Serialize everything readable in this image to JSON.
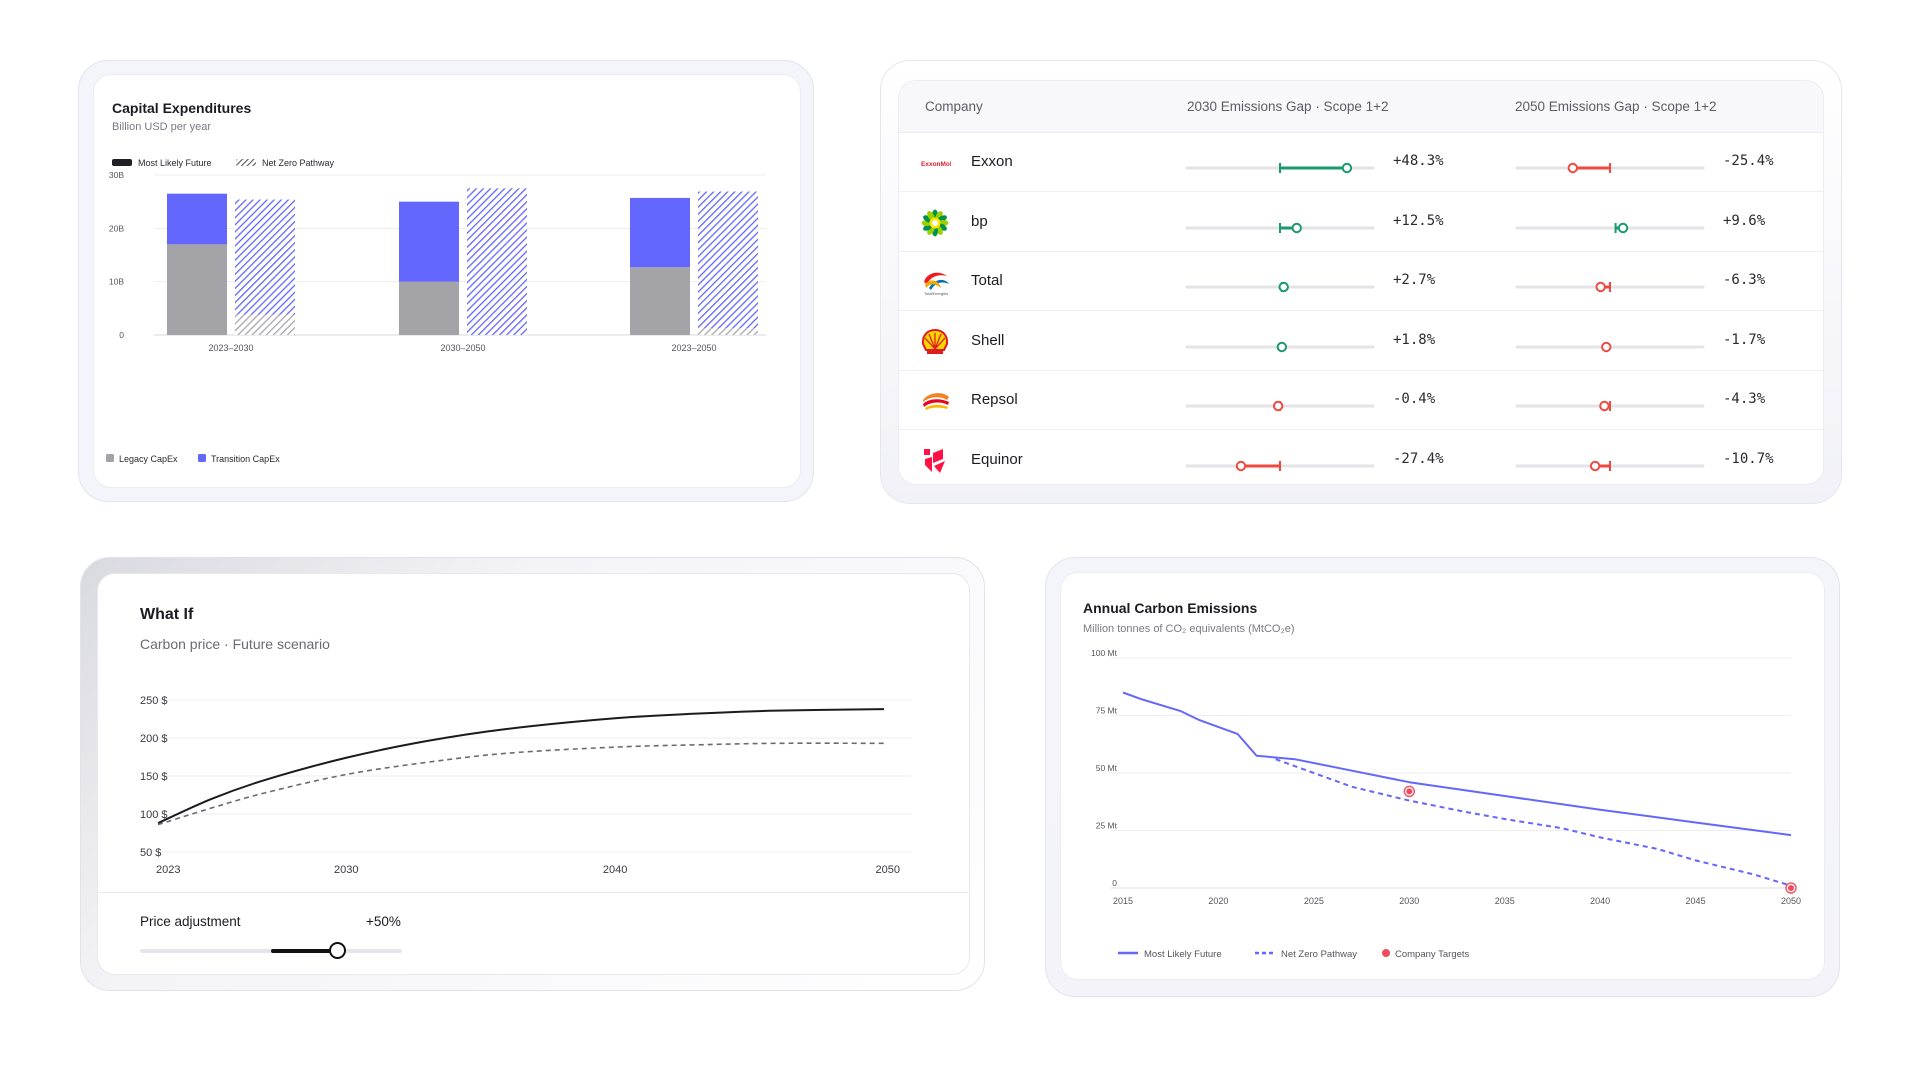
{
  "capex": {
    "title": "Capital Expenditures",
    "subtitle": "Billion USD per year",
    "legend_top": [
      "Most Likely Future",
      "Net Zero Pathway"
    ],
    "legend_bottom": [
      "Legacy CapEx",
      "Transition CapEx"
    ]
  },
  "emissions_gap": {
    "headers": [
      "Company",
      "2030 Emissions Gap · Scope 1+2",
      "2050 Emissions Gap · Scope 1+2"
    ],
    "rows": [
      {
        "company": "Exxon",
        "logo_icon": "exxonmobil-logo-icon",
        "logo_text": "ExxonMobil",
        "gap_2030": "+48.3%",
        "gap_2050": "-25.4%",
        "r2030": [
          50,
          86
        ],
        "r2050": [
          30,
          50
        ]
      },
      {
        "company": "bp",
        "logo_icon": "bp-helios-logo-icon",
        "gap_2030": "+12.5%",
        "gap_2050": "+9.6%",
        "r2030": [
          50,
          59
        ],
        "r2050": [
          53,
          57
        ]
      },
      {
        "company": "Total",
        "logo_icon": "totalenergies-logo-icon",
        "gap_2030": "+2.7%",
        "gap_2050": "-6.3%",
        "r2030": [
          51,
          52
        ],
        "r2050": [
          45,
          50
        ]
      },
      {
        "company": "Shell",
        "logo_icon": "shell-logo-icon",
        "gap_2030": "+1.8%",
        "gap_2050": "-1.7%",
        "r2030": [
          51,
          51
        ],
        "r2050": [
          48,
          48
        ]
      },
      {
        "company": "Repsol",
        "logo_icon": "repsol-logo-icon",
        "gap_2030": "-0.4%",
        "gap_2050": "-4.3%",
        "r2030": [
          49,
          50
        ],
        "r2050": [
          47,
          50
        ]
      },
      {
        "company": "Equinor",
        "logo_icon": "equinor-logo-icon",
        "gap_2030": "-27.4%",
        "gap_2050": "-10.7%",
        "r2030": [
          29,
          50
        ],
        "r2050": [
          42,
          50
        ]
      }
    ],
    "colors": {
      "positive": "#1a9a6c",
      "negative": "#ef4a42",
      "track": "#e3e3e8"
    }
  },
  "whatif": {
    "title": "What If",
    "subtitle": "Carbon price · Future scenario",
    "slider_label": "Price adjustment",
    "slider_value": "+50%",
    "slider_fraction": 0.75
  },
  "emissions": {
    "title": "Annual Carbon Emissions",
    "subtitle": "Million tonnes of CO₂ equivalents (MtCO₂e)",
    "legend": [
      "Most Likely Future",
      "Net Zero Pathway",
      "Company Targets"
    ]
  },
  "chart_data": [
    {
      "id": "capex",
      "type": "bar",
      "title": "Capital Expenditures",
      "subtitle": "Billion USD per year",
      "categories": [
        "2023–2030",
        "2030–2050",
        "2023–2050"
      ],
      "ylim": [
        0,
        30
      ],
      "ytick_labels": [
        "0",
        "10B",
        "20B",
        "30B"
      ],
      "yticks": [
        0,
        10,
        20,
        30
      ],
      "stacked": true,
      "series": [
        {
          "name": "Most Likely Future",
          "legacy": [
            17,
            10,
            12.7
          ],
          "transition": [
            9.5,
            15,
            13
          ]
        },
        {
          "name": "Net Zero Pathway",
          "legacy": [
            3.8,
            0,
            1.3
          ],
          "transition": [
            21.6,
            27.5,
            25.6
          ]
        }
      ],
      "colors": {
        "legacy": "#a3a3a8",
        "transition": "#6467fb",
        "legacy_hatch": "#bdbdc2",
        "transition_hatch": "#6467fb"
      },
      "grid": true
    },
    {
      "id": "carbon_price",
      "type": "line",
      "x": [
        2023,
        2025,
        2027,
        2030,
        2033,
        2036,
        2040,
        2043,
        2046,
        2050
      ],
      "xticks": [
        2023,
        2030,
        2040,
        2050
      ],
      "ylim": [
        50,
        250
      ],
      "yticks": [
        50,
        100,
        150,
        200,
        250
      ],
      "ytick_labels": [
        "50 $",
        "100 $",
        "150 $",
        "200 $",
        "250 $"
      ],
      "series": [
        {
          "name": "",
          "style": "solid",
          "color": "#1b1b1f",
          "values": [
            88,
            120,
            145,
            174,
            196,
            212,
            226,
            232,
            236,
            238
          ]
        },
        {
          "name": "",
          "style": "dashed",
          "color": "#6a6a70",
          "values": [
            86,
            108,
            128,
            152,
            168,
            180,
            188,
            191,
            193,
            193
          ]
        }
      ],
      "grid": true
    },
    {
      "id": "annual_emissions",
      "type": "line",
      "title": "Annual Carbon Emissions",
      "ylabel": "Million tonnes of CO₂ equivalents (MtCO₂e)",
      "xlim": [
        2015,
        2050
      ],
      "xticks": [
        2015,
        2020,
        2025,
        2030,
        2035,
        2040,
        2045,
        2050
      ],
      "ylim": [
        0,
        100
      ],
      "yticks": [
        0,
        25,
        50,
        75,
        100
      ],
      "ytick_labels": [
        "0",
        "25 Mt",
        "50 Mt",
        "75 Mt",
        "100 Mt"
      ],
      "series": [
        {
          "name": "Most Likely Future",
          "style": "solid",
          "color": "#6467fb",
          "x": [
            2015,
            2016,
            2018,
            2019,
            2021,
            2022,
            2024,
            2027,
            2030,
            2035,
            2040,
            2045,
            2050
          ],
          "values": [
            85,
            82,
            77,
            73,
            67,
            57.5,
            56,
            51,
            46,
            40,
            34,
            28.5,
            23
          ]
        },
        {
          "name": "Net Zero Pathway",
          "style": "dashed",
          "color": "#6467fb",
          "x": [
            2023,
            2025,
            2027,
            2030,
            2033,
            2035,
            2038,
            2040,
            2043,
            2045,
            2048,
            2050
          ],
          "values": [
            56,
            50,
            44,
            38,
            33,
            30,
            26,
            22,
            17,
            12,
            6,
            1
          ]
        },
        {
          "name": "Company Targets",
          "style": "points",
          "color": "#ef4a5e",
          "x": [
            2030,
            2050
          ],
          "values": [
            42,
            0
          ]
        }
      ],
      "grid": true,
      "legend_position": "bottom-left"
    }
  ]
}
